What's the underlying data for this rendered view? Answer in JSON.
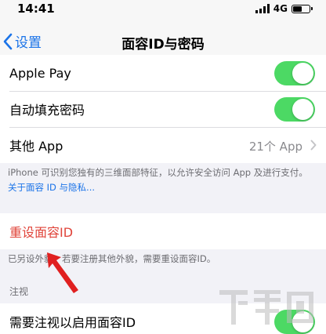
{
  "status_bar": {
    "time": "14:41",
    "network": "4G"
  },
  "nav": {
    "back_label": "设置",
    "title": "面容ID与密码"
  },
  "group1": {
    "items": [
      {
        "label": "Apple Pay",
        "toggle": "on"
      },
      {
        "label": "自动填充密码",
        "toggle": "on"
      },
      {
        "label": "其他 App",
        "value": "21个 App"
      }
    ]
  },
  "footnote1": {
    "text": "iPhone 可识别您独有的三维面部特征，以允许安全访问 App 及进行支付。",
    "link": "关于面容 ID 与隐私..."
  },
  "reset": {
    "label": "重设面容ID"
  },
  "footnote2": {
    "text": "已另设外貌。若要注册其他外貌，需要重设面容ID。"
  },
  "attention": {
    "header": "注视",
    "items": [
      {
        "label": "需要注视以启用面容ID",
        "toggle": "on"
      }
    ]
  },
  "colors": {
    "toggle_on": "#4cd964",
    "accent": "#1a73e8",
    "destructive": "#e0443a",
    "annotation_arrow": "#e02020"
  },
  "annotation": {
    "icon": "red-arrow-pointer"
  }
}
